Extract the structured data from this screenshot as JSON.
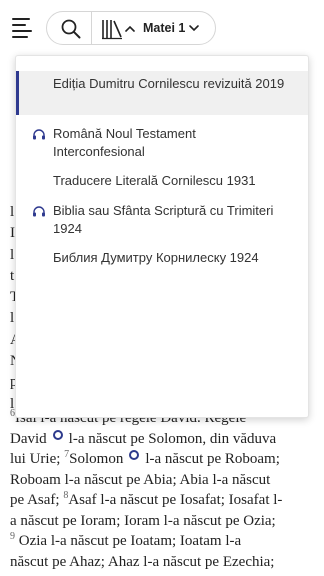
{
  "header": {
    "book_label": "Matei 1",
    "icons": {
      "menu": "hamburger-menu-icon",
      "search": "search-icon",
      "versions": "library-books-icon",
      "chevron": "chevron-icon"
    }
  },
  "versions": [
    {
      "name": "Ediția Dumitru Cornilescu revizuită 2019",
      "active": true,
      "audio": false
    },
    {
      "name": "Română Noul Testament Interconfesional",
      "active": false,
      "audio": true
    },
    {
      "name": "Traducere Literală Cornilescu 1931",
      "active": false,
      "audio": false
    },
    {
      "name": "Biblia sau Sfânta Scriptură cu Trimiteri 1924",
      "active": false,
      "audio": true
    },
    {
      "name": "Библия Думитру Корнилеску 1924",
      "active": false,
      "audio": false
    }
  ],
  "scripture": {
    "partial_left_chars": [
      "l",
      "I",
      "l",
      "t",
      "T",
      "l",
      "A",
      "N",
      "p",
      "l"
    ],
    "line_1": "Isai   l-a născut pe regele David. Regele",
    "verse_6_num": "6",
    "line_2_a": "David",
    "line_2_b": "l-a născut pe Solomon, din văduva",
    "line_3_a": "lui Urie;",
    "verse_7_num": "7",
    "line_3_b": "Solomon",
    "line_3_c": "l-a născut pe Roboam;",
    "line_4": "Roboam l-a născut pe Abia; Abia l-a născut",
    "line_5_a": "pe Asaf;",
    "verse_8_num": "8",
    "line_5_b": "Asaf l-a născut pe Iosafat; Iosafat l-",
    "line_6": "a născut pe Ioram; Ioram l-a născut pe Ozia;",
    "verse_9_num": "9",
    "line_7": "Ozia l-a născut pe Ioatam; Ioatam l-a",
    "line_8": "născut pe Ahaz; Ahaz l-a născut pe Ezechia;"
  },
  "colors": {
    "accent": "#2f3a8f",
    "active_bg": "#f0f0f0"
  }
}
